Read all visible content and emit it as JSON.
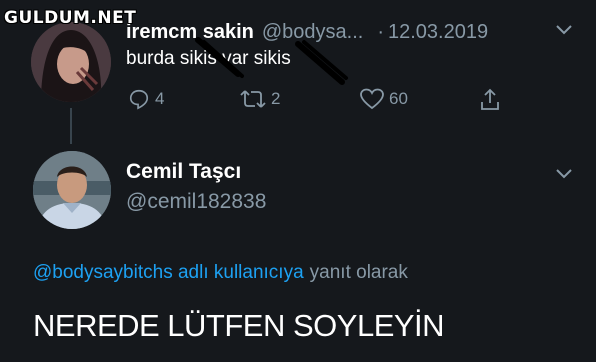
{
  "watermark": "GULDUM.NET",
  "tweet1": {
    "name": "iremcm sakin",
    "handle": "@bodysa...",
    "separator": "·",
    "date": "12.03.2019",
    "text": "burda sikis var sikis",
    "actions": {
      "reply_count": "4",
      "retweet_count": "2",
      "like_count": "60"
    },
    "menu_icon": "chevron-down-icon"
  },
  "tweet2": {
    "name": "Cemil Taşcı",
    "handle": "@cemil182838",
    "replying_to": {
      "mention": "@bodysaybitchs adlı kullanıcıya",
      "suffix": "yanıt olarak"
    },
    "text": "NEREDE LÜTFEN SOYLEYİN",
    "menu_icon": "chevron-down-icon"
  },
  "colors": {
    "background": "#15181c",
    "secondary_text": "#8899a6",
    "link": "#1da1f2",
    "thread_line": "#38444d"
  }
}
